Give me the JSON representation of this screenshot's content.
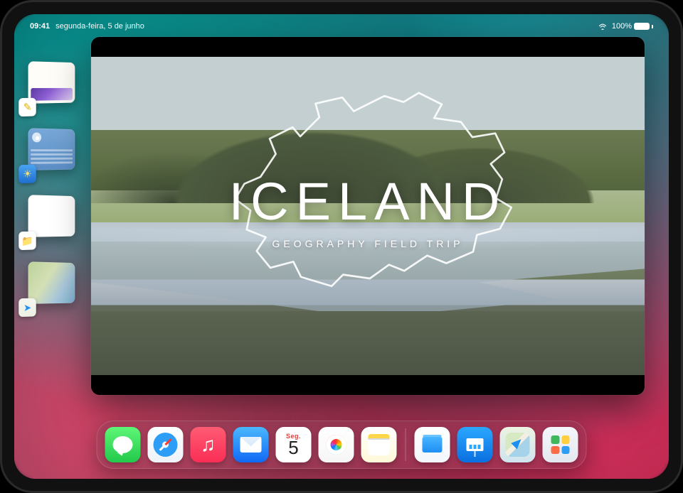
{
  "status": {
    "time": "09:41",
    "date": "segunda-feira, 5 de junho",
    "battery_percent": "100%"
  },
  "stage_manager": {
    "items": [
      {
        "app": "Notas",
        "icon_bg": "linear-gradient(#fff,#fff)",
        "icon_sym": "✎",
        "icon_sym_color": "#e0b000"
      },
      {
        "app": "Tempo",
        "icon_bg": "linear-gradient(#4aa3f0,#1f6fd1)",
        "icon_sym": "☀",
        "icon_sym_color": "#ffe36b"
      },
      {
        "app": "Ficheiros",
        "icon_bg": "linear-gradient(#fff,#fff)",
        "icon_sym": "📁",
        "icon_sym_color": "#2e9df5"
      },
      {
        "app": "Mapas",
        "icon_bg": "linear-gradient(#f5f5f0,#f5f5f0)",
        "icon_sym": "➤",
        "icon_sym_color": "#1d8ef3"
      }
    ]
  },
  "main_window": {
    "title": "ICELAND",
    "subtitle": "GEOGRAPHY FIELD TRIP"
  },
  "calendar_icon": {
    "dow": "Seg.",
    "day": "5"
  },
  "dock": {
    "apps": [
      {
        "name": "Mensagens",
        "bg": "linear-gradient(#5ef777,#22c94b)",
        "sym": "✉",
        "icon": "messages-icon"
      },
      {
        "name": "Safari",
        "bg": "linear-gradient(#ffffff,#eef3f8)",
        "sym": "🧭",
        "icon": "safari-icon"
      },
      {
        "name": "Música",
        "bg": "linear-gradient(#ff5c74,#fa2d55)",
        "sym": "♪",
        "icon": "music-icon"
      },
      {
        "name": "Mail",
        "bg": "linear-gradient(#4ab8ff,#1169f5)",
        "sym": "✉",
        "icon": "mail-icon"
      },
      {
        "name": "Calendário",
        "bg": "#fff",
        "sym": "",
        "icon": "calendar-icon",
        "is_calendar": true
      },
      {
        "name": "Fotografias",
        "bg": "linear-gradient(#ffffff,#f6f6f6)",
        "sym": "✿",
        "icon": "photos-icon"
      },
      {
        "name": "Notas",
        "bg": "linear-gradient(#ffffff,#fff9d9)",
        "sym": "✎",
        "icon": "notes-icon"
      }
    ],
    "recents": [
      {
        "name": "Ficheiros",
        "bg": "linear-gradient(#ffffff,#f2f7fc)",
        "sym": "📁",
        "icon": "files-icon"
      },
      {
        "name": "Keynote",
        "bg": "linear-gradient(#2aa7ff,#0a6fe0)",
        "sym": "▭",
        "icon": "keynote-icon"
      },
      {
        "name": "Mapas",
        "bg": "linear-gradient(#ecf3e1,#cfe4ef)",
        "sym": "➤",
        "icon": "maps-icon"
      },
      {
        "name": "Atalhos/Apps",
        "bg": "linear-gradient(#f4f6fa,#e4e8ef)",
        "sym": "▦",
        "icon": "app-library-icon"
      }
    ]
  }
}
